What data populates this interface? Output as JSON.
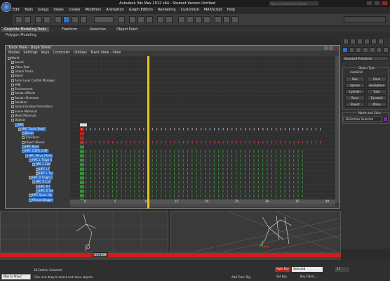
{
  "app": {
    "title": "Autodesk 3ds Max 2012 x64 - Student Version Untitled",
    "search_placeholder": "Type a keyword or phrase"
  },
  "menubar": [
    "Edit",
    "Tools",
    "Group",
    "Views",
    "Create",
    "Modifiers",
    "Animation",
    "Graph Editors",
    "Rendering",
    "Customize",
    "MAXScript",
    "Help"
  ],
  "ribbon": {
    "tabs": [
      "Graphite Modeling Tools",
      "Freeform",
      "Selection",
      "Object Paint"
    ],
    "active_index": 0,
    "sub": "Polygon Modeling"
  },
  "trackview": {
    "title": "Track View - Dope Sheet",
    "menu": [
      "Modes",
      "Settings",
      "Keys",
      "Controller",
      "Utilities",
      "Track View - View"
    ],
    "tree": [
      {
        "label": "World",
        "depth": 0,
        "sel": false
      },
      {
        "label": "Sound",
        "depth": 1,
        "sel": false
      },
      {
        "label": "Video Post",
        "depth": 1,
        "sel": false
      },
      {
        "label": "Global Tracks",
        "depth": 1,
        "sel": false
      },
      {
        "label": "Biped",
        "depth": 1,
        "sel": false
      },
      {
        "label": "Anim Layer Control Manager",
        "depth": 1,
        "sel": false
      },
      {
        "label": "SME",
        "depth": 1,
        "sel": false
      },
      {
        "label": "Environment",
        "depth": 1,
        "sel": false
      },
      {
        "label": "Render Effects",
        "depth": 1,
        "sel": false
      },
      {
        "label": "Render Elements",
        "depth": 1,
        "sel": false
      },
      {
        "label": "Renderer",
        "depth": 1,
        "sel": false
      },
      {
        "label": "Global Shadow Parameters",
        "depth": 1,
        "sel": false
      },
      {
        "label": "Scene Materials",
        "depth": 1,
        "sel": false
      },
      {
        "label": "Medit Materials",
        "depth": 1,
        "sel": false
      },
      {
        "label": "Objects",
        "depth": 1,
        "sel": false
      },
      {
        "label": "HPC",
        "depth": 2,
        "sel": true
      },
      {
        "label": "HPC Trash [Root]",
        "depth": 3,
        "sel": true
      },
      {
        "label": "Bones",
        "depth": 4,
        "sel": true
      },
      {
        "label": "Transform",
        "depth": 4,
        "sel": false
      },
      {
        "label": "Object (Bone)",
        "depth": 4,
        "sel": false
      },
      {
        "label": "HPC Bone",
        "depth": 4,
        "sel": true
      },
      {
        "label": "HPC COM [COM]",
        "depth": 4,
        "sel": true
      },
      {
        "label": "HPC Pelvis [Pelv]",
        "depth": 5,
        "sel": true
      },
      {
        "label": "HPC L Thigh [I",
        "depth": 6,
        "sel": true
      },
      {
        "label": "HPC L Calf",
        "depth": 7,
        "sel": true
      },
      {
        "label": "HPC L F",
        "depth": 8,
        "sel": true
      },
      {
        "label": "HPC L Toe",
        "depth": 8,
        "sel": true
      },
      {
        "label": "HPC R Thigh [I",
        "depth": 6,
        "sel": true
      },
      {
        "label": "HPC R Calf",
        "depth": 7,
        "sel": true
      },
      {
        "label": "HPC R F",
        "depth": 8,
        "sel": true
      },
      {
        "label": "HPC R Toe",
        "depth": 8,
        "sel": true
      },
      {
        "label": "HPC Spine [Sp",
        "depth": 6,
        "sel": true
      },
      {
        "label": "MissionDagger",
        "depth": 6,
        "sel": true
      }
    ],
    "ruler_ticks": [
      "0",
      "5",
      "10",
      "15",
      "20",
      "25",
      "30",
      "35",
      "40"
    ],
    "current_frame": "11"
  },
  "panel": {
    "dropdown": "Standard Primitives",
    "object_type_title": "Object Type",
    "autogrid": "AutoGrid",
    "buttons": [
      "Box",
      "Cone",
      "Sphere",
      "GeoSphere",
      "Cylinder",
      "Tube",
      "Torus",
      "Pyramid",
      "Teapot",
      "Plane"
    ],
    "name_color_title": "Name and Color",
    "name_value": "38 Entities Selected"
  },
  "timeline": {
    "frame_label": "11 / 100"
  },
  "status": {
    "maxscript_label": "Max to Physc",
    "selected": "38 Entities Selected",
    "prompt": "Click and drag to select and move objects",
    "add_time_tag": "Add Time Tag",
    "autokey": "Auto Key",
    "selected_dropdown": "Selected",
    "setkey": "Set Key",
    "keyfilters": "Key Filters...",
    "frame_field": "11"
  },
  "colors": {
    "accent": "#2f6fc4",
    "playhead": "#e8c61c",
    "timeslider": "#d21b1b",
    "object_color": "#7b2e9e"
  }
}
